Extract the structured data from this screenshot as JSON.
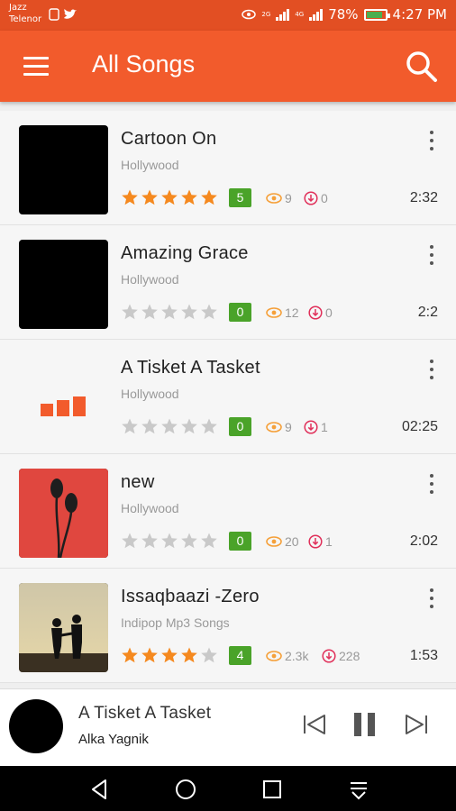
{
  "status_bar": {
    "carrier_1": "Jazz",
    "carrier_2": "Telenor",
    "signal_tag_1": "2G",
    "signal_tag_2": "4G",
    "battery": "78%",
    "time": "4:27 PM"
  },
  "app_bar": {
    "title": "All Songs",
    "menu_icon": "menu-icon",
    "search_icon": "search-icon"
  },
  "songs": [
    {
      "title": "Cartoon On",
      "subtitle": "Hollywood",
      "rating": 5,
      "rating_label": "5",
      "views": "9",
      "downloads": "0",
      "duration": "2:32",
      "thumb": "black"
    },
    {
      "title": "Amazing Grace",
      "subtitle": "Hollywood",
      "rating": 0,
      "rating_label": "0",
      "views": "12",
      "downloads": "0",
      "duration": "2:2",
      "thumb": "black"
    },
    {
      "title": "A Tisket A Tasket",
      "subtitle": "Hollywood",
      "rating": 0,
      "rating_label": "0",
      "views": "9",
      "downloads": "1",
      "duration": "02:25",
      "thumb": "bars"
    },
    {
      "title": "new",
      "subtitle": "Hollywood",
      "rating": 0,
      "rating_label": "0",
      "views": "20",
      "downloads": "1",
      "duration": "2:02",
      "thumb": "earphones"
    },
    {
      "title": "Issaqbaazi -Zero",
      "subtitle": "Indipop Mp3 Songs",
      "rating": 4,
      "rating_label": "4",
      "views": "2.3k",
      "downloads": "228",
      "duration": "1:53",
      "thumb": "sunset"
    }
  ],
  "player": {
    "title": "A Tisket A Tasket",
    "artist": "Alka Yagnik",
    "controls": [
      "previous-icon",
      "pause-icon",
      "next-icon"
    ]
  },
  "nav_bar": {
    "buttons": [
      "back-icon",
      "home-icon",
      "recents-icon",
      "notifications-icon"
    ]
  },
  "colors": {
    "status_bar": "#e24f23",
    "app_bar": "#f25b2c",
    "star_on": "#f5891f",
    "star_off": "#c9c9c9",
    "rating_badge": "#4aa329",
    "views_icon": "#f5a03a",
    "downloads_icon": "#e0305a"
  }
}
